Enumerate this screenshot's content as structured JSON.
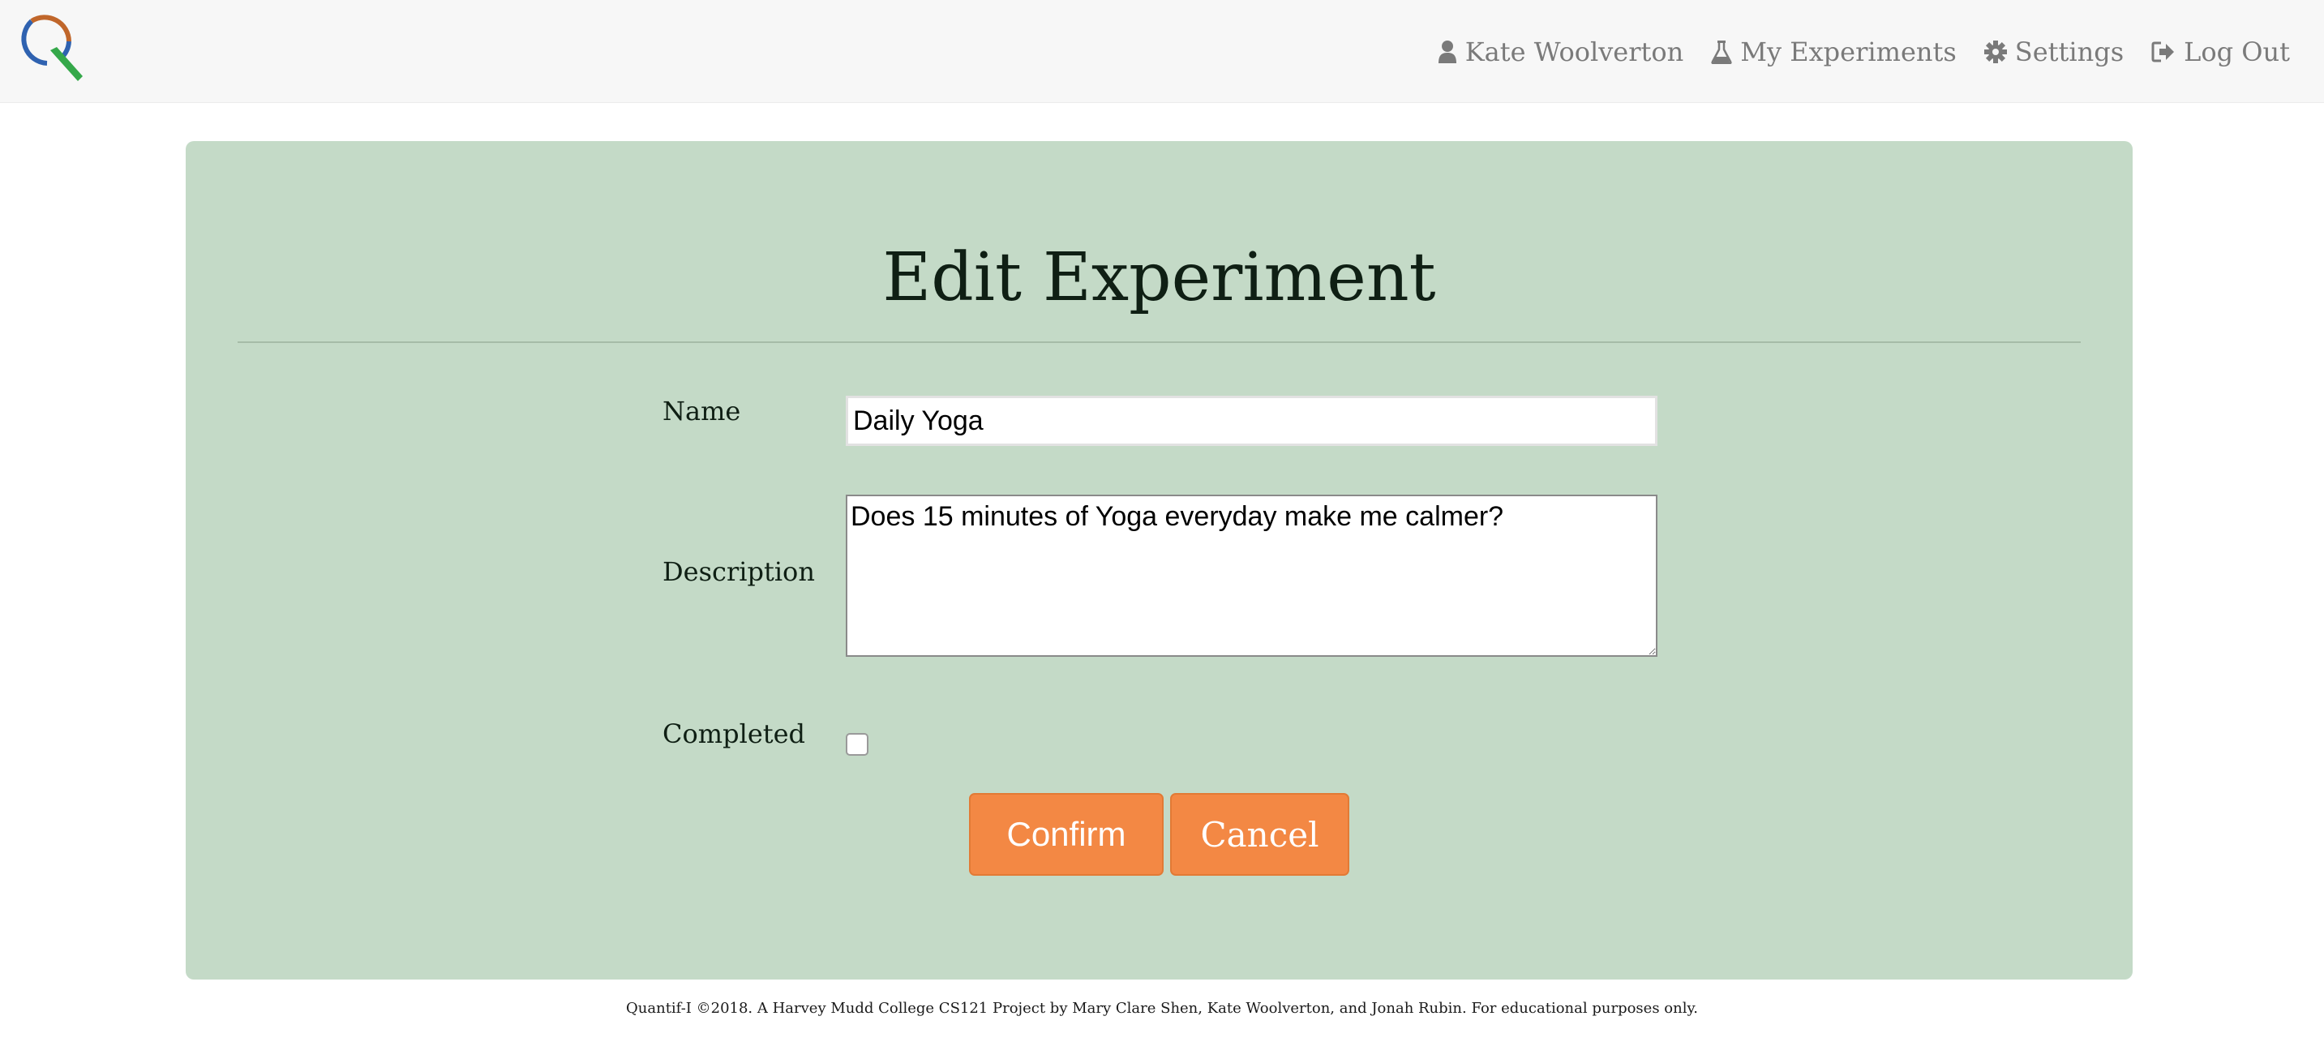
{
  "nav": {
    "logo_icon": "quantif-i-magnifier-logo",
    "user": {
      "icon": "user-icon",
      "label": "Kate Woolverton"
    },
    "experiments": {
      "icon": "flask-icon",
      "label": "My Experiments"
    },
    "settings": {
      "icon": "gear-icon",
      "label": "Settings"
    },
    "logout": {
      "icon": "sign-out-icon",
      "label": "Log Out"
    }
  },
  "form": {
    "title": "Edit Experiment",
    "name_label": "Name",
    "name_value": "Daily Yoga",
    "description_label": "Description",
    "description_value": "Does 15 minutes of Yoga everyday make me calmer?",
    "completed_label": "Completed",
    "completed_checked": false,
    "confirm_label": "Confirm",
    "cancel_label": "Cancel"
  },
  "footer": {
    "text": "Quantif-I ©2018. A Harvey Mudd College CS121 Project by Mary Clare Shen, Kate Woolverton, and Jonah Rubin. For educational purposes only."
  },
  "colors": {
    "navbar_bg": "#f7f7f7",
    "nav_text": "#7a7a7a",
    "card_bg": "#c4dac7",
    "button_bg": "#f38844",
    "logo_blue": "#2f62b0",
    "logo_orange": "#c0662a",
    "logo_green": "#35a84a"
  }
}
